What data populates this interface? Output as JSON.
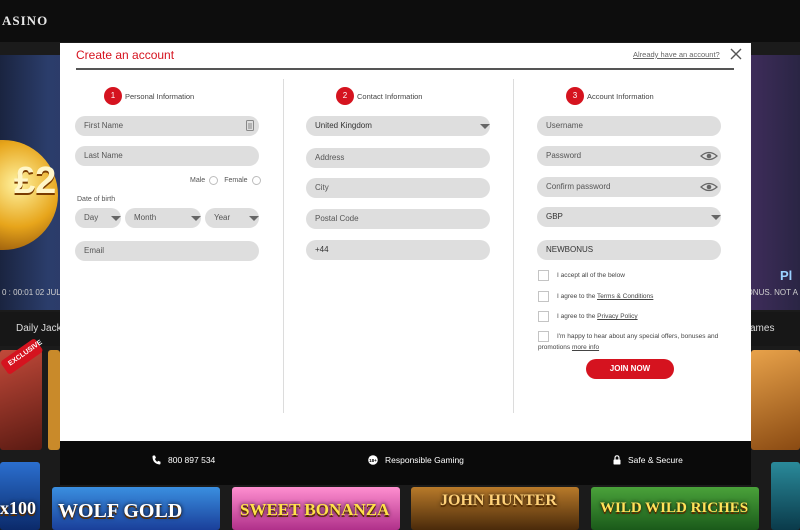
{
  "background": {
    "brand": "ASINO",
    "banner_text": "£2",
    "ticker_left": "0 : 00:01 02 JUL",
    "ticker_right": "ONUS. NOT A",
    "banner_right_text": "Pl",
    "nav_left": "Daily Jackp",
    "nav_right": "ames",
    "games": [
      "WOLF GOLD",
      "SWEET BONANZA",
      "JOHN HUNTER",
      "WILD WILD RICHES"
    ],
    "exclusive_badge": "EXCLUSIVE",
    "partial_tile_text": "x100"
  },
  "modal": {
    "title": "Create an account",
    "login_link": "Already have an account?",
    "steps": [
      {
        "num": "1",
        "label": "Personal Information"
      },
      {
        "num": "2",
        "label": "Contact Information"
      },
      {
        "num": "3",
        "label": "Account Information"
      }
    ],
    "personal": {
      "first_name": "First Name",
      "last_name": "Last Name",
      "male": "Male",
      "female": "Female",
      "dob_label": "Date of birth",
      "day": "Day",
      "month": "Month",
      "year": "Year",
      "email": "Email"
    },
    "contact": {
      "country": "United Kingdom",
      "address": "Address",
      "city": "City",
      "postcode": "Postal Code",
      "phone": "+44"
    },
    "account": {
      "username": "Username",
      "password": "Password",
      "confirm_password": "Confirm password",
      "currency": "GBP",
      "bonus_code": "NEWBONUS",
      "accept_all": "I accept all of the below",
      "terms_prefix": "I agree to the",
      "terms_link": "Terms & Conditions",
      "privacy_prefix": "I agree to the",
      "privacy_link": "Privacy Policy",
      "offers_text": "I'm happy to hear about any special offers, bonuses and promotions",
      "more_info": "more info",
      "join_button": "JOIN NOW"
    },
    "footer": {
      "phone": "800 897 534",
      "responsible": "Responsible Gaming",
      "secure": "Safe & Secure"
    }
  },
  "colors": {
    "accent": "#d5131f",
    "field_bg": "#dedede",
    "footer_bg": "#0a0a0a"
  }
}
